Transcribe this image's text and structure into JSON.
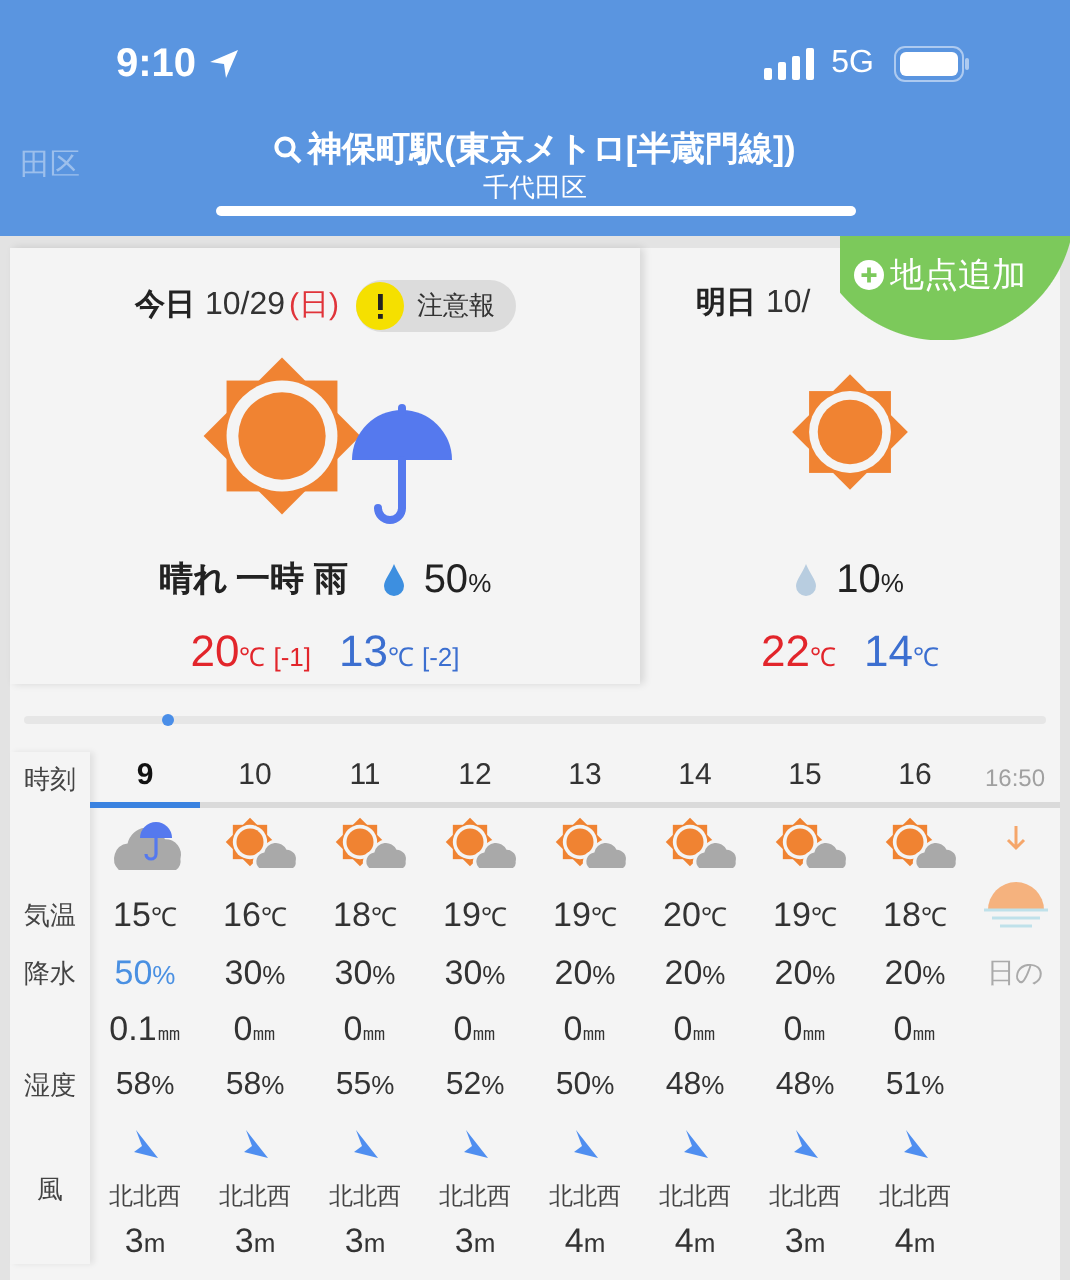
{
  "status_bar": {
    "time": "9:10",
    "network": "5G"
  },
  "header": {
    "side_label": "田区",
    "title": "神保町駅(東京メトロ[半蔵門線])",
    "subtitle": "千代田区"
  },
  "add_button": "地点追加",
  "days": [
    {
      "label": "今日",
      "date": "10/29",
      "weekday": "(日)",
      "warning": "注意報",
      "kind": "sun_umbrella",
      "weather_text": "晴れ 一時 雨",
      "color": "#3d8fe0",
      "precip": "50%",
      "high": "20℃",
      "high_diff": "[-1]",
      "low": "13℃",
      "low_diff": "[-2]"
    },
    {
      "label": "明日",
      "date": "10/",
      "kind": "sun",
      "color": "#b8cde0",
      "precip": "10%",
      "high": "22℃",
      "low": "14℃"
    }
  ],
  "hourly": {
    "row_labels": [
      "時刻",
      "気温",
      "降水",
      "湿度",
      "風"
    ],
    "hours": [
      {
        "time": "9",
        "selected": true,
        "kind": "cloud_umbrella",
        "temp": "15℃",
        "precip": "50%",
        "precip_high": true,
        "amount": "0.1㎜",
        "humidity": "58%",
        "wind_dir": "北北西",
        "wind_speed": "3m"
      },
      {
        "time": "10",
        "selected": false,
        "kind": "sun_cloud",
        "temp": "16℃",
        "precip": "30%",
        "precip_high": false,
        "amount": "0㎜",
        "humidity": "58%",
        "wind_dir": "北北西",
        "wind_speed": "3m"
      },
      {
        "time": "11",
        "selected": false,
        "kind": "sun_cloud",
        "temp": "18℃",
        "precip": "30%",
        "precip_high": false,
        "amount": "0㎜",
        "humidity": "55%",
        "wind_dir": "北北西",
        "wind_speed": "3m"
      },
      {
        "time": "12",
        "selected": false,
        "kind": "sun_cloud",
        "temp": "19℃",
        "precip": "30%",
        "precip_high": false,
        "amount": "0㎜",
        "humidity": "52%",
        "wind_dir": "北北西",
        "wind_speed": "3m"
      },
      {
        "time": "13",
        "selected": false,
        "kind": "sun_cloud",
        "temp": "19℃",
        "precip": "20%",
        "precip_high": false,
        "amount": "0㎜",
        "humidity": "50%",
        "wind_dir": "北北西",
        "wind_speed": "4m"
      },
      {
        "time": "14",
        "selected": false,
        "kind": "sun_cloud",
        "temp": "20℃",
        "precip": "20%",
        "precip_high": false,
        "amount": "0㎜",
        "humidity": "48%",
        "wind_dir": "北北西",
        "wind_speed": "4m"
      },
      {
        "time": "15",
        "selected": false,
        "kind": "sun_cloud",
        "temp": "19℃",
        "precip": "20%",
        "precip_high": false,
        "amount": "0㎜",
        "humidity": "48%",
        "wind_dir": "北北西",
        "wind_speed": "3m"
      },
      {
        "time": "16",
        "selected": false,
        "kind": "sun_cloud",
        "temp": "18℃",
        "precip": "20%",
        "precip_high": false,
        "amount": "0㎜",
        "humidity": "51%",
        "wind_dir": "北北西",
        "wind_speed": "4m"
      }
    ],
    "sunset": {
      "time": "16:50",
      "label": "日の"
    }
  }
}
